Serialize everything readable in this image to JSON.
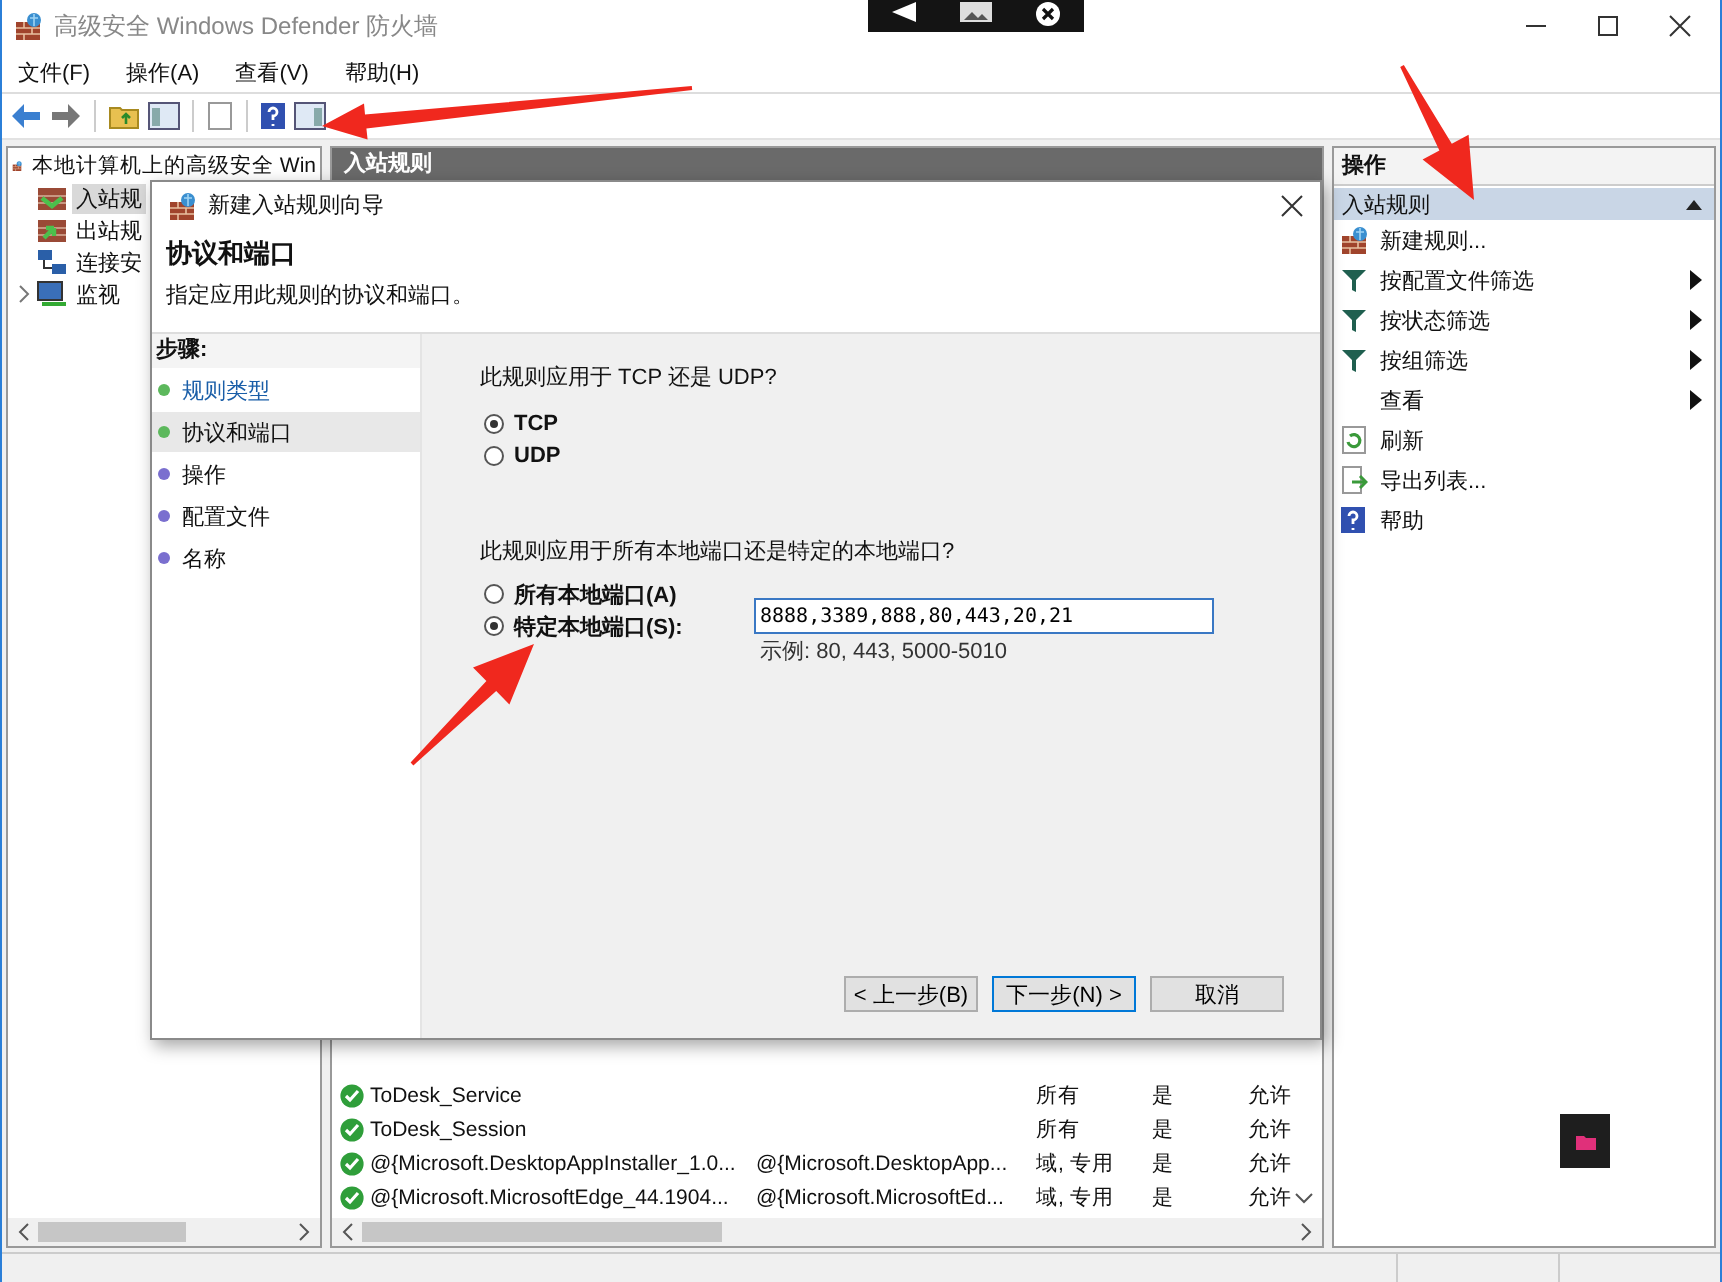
{
  "window": {
    "title": "高级安全 Windows Defender 防火墙"
  },
  "menu": [
    "文件(F)",
    "操作(A)",
    "查看(V)",
    "帮助(H)"
  ],
  "tree": {
    "label": "本地计算机上的高级安全 Win",
    "children": [
      {
        "label": "入站规",
        "selected": true,
        "kind": "inbound"
      },
      {
        "label": "出站规",
        "selected": false,
        "kind": "outbound"
      },
      {
        "label": "连接安",
        "selected": false,
        "kind": "security"
      },
      {
        "label": "监视",
        "selected": false,
        "kind": "monitoring",
        "expanded": false
      }
    ]
  },
  "center": {
    "title": "入站规则",
    "rows": [
      {
        "name": "ToDesk_Service",
        "profile": "所有",
        "enabled": "是",
        "action": "允许"
      },
      {
        "name": "ToDesk_Session",
        "profile": "所有",
        "enabled": "是",
        "action": "允许"
      },
      {
        "name": "@{Microsoft.DesktopAppInstaller_1.0...",
        "group": "@{Microsoft.DesktopApp...",
        "profile": "域, 专用",
        "enabled": "是",
        "action": "允许"
      },
      {
        "name": "@{Microsoft.MicrosoftEdge_44.1904...",
        "group": "@{Microsoft.MicrosoftEd...",
        "profile": "域, 专用",
        "enabled": "是",
        "action": "允许"
      }
    ]
  },
  "actions": {
    "title": "操作",
    "section": "入站规则",
    "items": [
      {
        "label": "新建规则...",
        "kind": "new",
        "submenu": false
      },
      {
        "label": "按配置文件筛选",
        "kind": "filter",
        "submenu": true
      },
      {
        "label": "按状态筛选",
        "kind": "filter",
        "submenu": true
      },
      {
        "label": "按组筛选",
        "kind": "filter",
        "submenu": true
      },
      {
        "label": "查看",
        "kind": "view",
        "submenu": true
      },
      {
        "label": "刷新",
        "kind": "refresh",
        "submenu": false
      },
      {
        "label": "导出列表...",
        "kind": "export",
        "submenu": false
      },
      {
        "label": "帮助",
        "kind": "help",
        "submenu": false
      }
    ]
  },
  "dialog": {
    "title": "新建入站规则向导",
    "heading": "协议和端口",
    "subtitle": "指定应用此规则的协议和端口。",
    "steps_title": "步骤:",
    "steps": [
      {
        "label": "规则类型",
        "selected": false,
        "color": "#5cb85c",
        "link": true
      },
      {
        "label": "协议和端口",
        "selected": true,
        "color": "#5cb85c",
        "link": false
      },
      {
        "label": "操作",
        "selected": false,
        "color": "#7a6fcf",
        "link": false
      },
      {
        "label": "配置文件",
        "selected": false,
        "color": "#7a6fcf",
        "link": false
      },
      {
        "label": "名称",
        "selected": false,
        "color": "#7a6fcf",
        "link": false
      }
    ],
    "protocol_question": "此规则应用于 TCP 还是 UDP?",
    "protocols": [
      {
        "label": "TCP",
        "selected": true
      },
      {
        "label": "UDP",
        "selected": false
      }
    ],
    "port_question": "此规则应用于所有本地端口还是特定的本地端口?",
    "ports": [
      {
        "label": "所有本地端口(A)",
        "selected": false
      },
      {
        "label": "特定本地端口(S):",
        "selected": true
      }
    ],
    "port_field": {
      "value": "8888,3389,888,80,443,20,21"
    },
    "port_hint": "示例: 80, 443, 5000-5010",
    "buttons": [
      {
        "label": "< 上一步(B)",
        "default": false
      },
      {
        "label": "下一步(N) >",
        "default": true
      },
      {
        "label": "取消",
        "default": false
      }
    ]
  },
  "annotations": [
    {
      "kind": "arrow"
    },
    {
      "kind": "arrow"
    },
    {
      "kind": "arrow"
    }
  ]
}
